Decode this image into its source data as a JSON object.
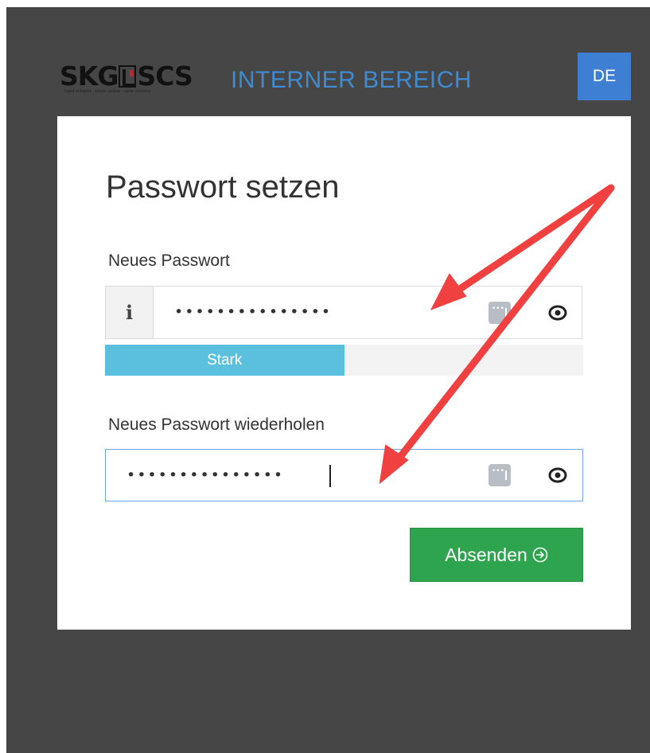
{
  "header": {
    "logo_text": "SKG",
    "logo_text_2": "SCS",
    "logo_tagline": "hand schweiz · ohren suisse · cane svizzero",
    "area_title": "INTERNER BEREICH",
    "language": "DE"
  },
  "form": {
    "title": "Passwort setzen",
    "new_password": {
      "label": "Neues Passwort",
      "info": "i",
      "value": "•••••••••••••••"
    },
    "strength": {
      "label": "Stark",
      "level": 0.5
    },
    "repeat_password": {
      "label": "Neues Passwort wiederholen",
      "value": "•••••••••••••••"
    },
    "submit_label": "Absenden"
  },
  "colors": {
    "background": "#464646",
    "accent": "#3f8bd1",
    "language_button": "#3f7fd3",
    "strength_bar": "#5bc0de",
    "submit": "#2ea44f",
    "annotation_arrow": "#f04040"
  },
  "icons": {
    "info": "info-icon",
    "password_manager": "password-manager-icon",
    "visibility": "eye-icon",
    "submit": "arrow-circle-right-icon"
  }
}
